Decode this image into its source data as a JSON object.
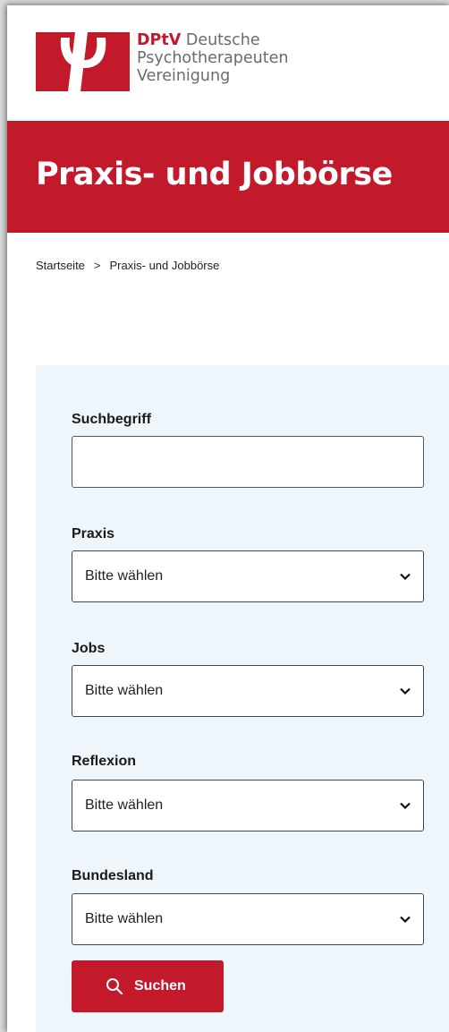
{
  "brand": {
    "abbr": "DPtV",
    "line1_rest": "Deutsche",
    "line2": "Psychotherapeuten",
    "line3": "Vereinigung",
    "color_primary": "#c2192b",
    "logo_icon": "psi-logo-icon"
  },
  "page": {
    "title": "Praxis- und Jobbörse"
  },
  "breadcrumb": {
    "items": [
      "Startseite",
      "Praxis- und Jobbörse"
    ],
    "separator": ">"
  },
  "search": {
    "fields": [
      {
        "label": "Suchbegriff",
        "type": "text",
        "value": ""
      },
      {
        "label": "Praxis",
        "type": "select",
        "value": "Bitte wählen"
      },
      {
        "label": "Jobs",
        "type": "select",
        "value": "Bitte wählen"
      },
      {
        "label": "Reflexion",
        "type": "select",
        "value": "Bitte wählen"
      },
      {
        "label": "Bundesland",
        "type": "select",
        "value": "Bitte wählen"
      }
    ],
    "submit_label": "Suchen",
    "submit_icon": "search-icon",
    "panel_bg": "#eef5fb"
  }
}
